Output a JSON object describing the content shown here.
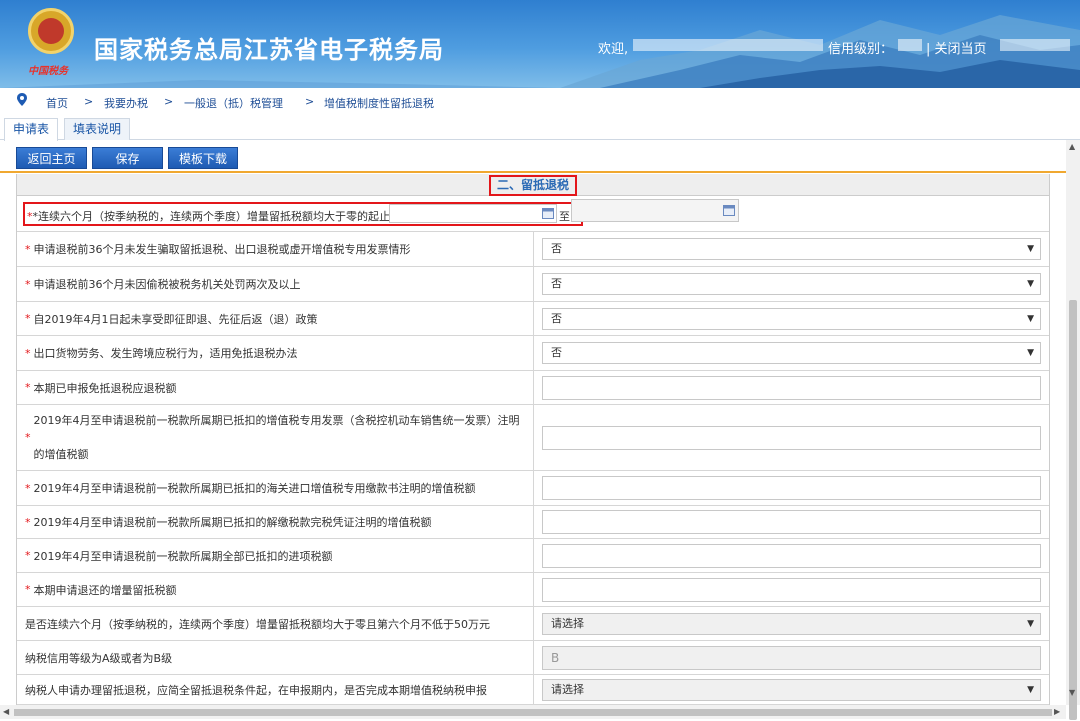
{
  "header": {
    "site_title": "国家税务总局江苏省电子税务局",
    "seal_text": "中国税务",
    "welcome": "欢迎,",
    "credit_level": "信用级别：",
    "close_page": "| 关闭当页"
  },
  "breadcrumb": {
    "items": [
      "首页",
      "我要办税",
      "一般退（抵）税管理",
      "增值税制度性留抵退税"
    ],
    "separator": ">"
  },
  "tabs": [
    {
      "label": "申请表",
      "active": true
    },
    {
      "label": "填表说明",
      "active": false
    }
  ],
  "toolbar": {
    "back_label": "返回主页",
    "save_label": "保存",
    "template_label": "模板下载"
  },
  "section": {
    "title": "二、留抵退税"
  },
  "date_row": {
    "label": "*连续六个月（按季纳税的，连续两个季度）增量留抵税额均大于零的起止时间：",
    "to": "至"
  },
  "rows": [
    {
      "label": "申请退税前36个月未发生骗取留抵退税、出口退税或虚开增值税专用发票情形",
      "required": true,
      "type": "select",
      "value": "否"
    },
    {
      "label": "申请退税前36个月未因偷税被税务机关处罚两次及以上",
      "required": true,
      "type": "select",
      "value": "否"
    },
    {
      "label": "自2019年4月1日起未享受即征即退、先征后返（退）政策",
      "required": true,
      "type": "select",
      "value": "否"
    },
    {
      "label": "出口货物劳务、发生跨境应税行为，适用免抵退税办法",
      "required": true,
      "type": "select",
      "value": "否"
    },
    {
      "label": "本期已申报免抵退税应退税额",
      "required": true,
      "type": "input",
      "value": ""
    },
    {
      "label": "2019年4月至申请退税前一税款所属期已抵扣的增值税专用发票（含税控机动车销售统一发票）注明的增值税额",
      "required": true,
      "type": "input",
      "value": "",
      "tall": true
    },
    {
      "label": "2019年4月至申请退税前一税款所属期已抵扣的海关进口增值税专用缴款书注明的增值税额",
      "required": true,
      "type": "input",
      "value": ""
    },
    {
      "label": "2019年4月至申请退税前一税款所属期已抵扣的解缴税款完税凭证注明的增值税额",
      "required": true,
      "type": "input",
      "value": ""
    },
    {
      "label": "2019年4月至申请退税前一税款所属期全部已抵扣的进项税额",
      "required": true,
      "type": "input",
      "value": ""
    },
    {
      "label": "本期申请退还的增量留抵税额",
      "required": true,
      "type": "input",
      "value": ""
    },
    {
      "label": "是否连续六个月（按季纳税的，连续两个季度）增量留抵税额均大于零且第六个月不低于50万元",
      "required": false,
      "type": "select",
      "value": "请选择",
      "disabled": true
    },
    {
      "label": "纳税信用等级为A级或者为B级",
      "required": false,
      "type": "input",
      "value": "B",
      "disabled": true
    },
    {
      "label": "纳税人申请办理留抵退税，应简全留抵退税条件起，在申报期内，是否完成本期增值税纳税申报",
      "required": false,
      "type": "select",
      "value": "请选择",
      "disabled": true
    }
  ],
  "colors": {
    "accent": "#1e5bb3",
    "required": "#e3161a",
    "highlight_box": "#e3161a",
    "divider": "#f0a830"
  }
}
